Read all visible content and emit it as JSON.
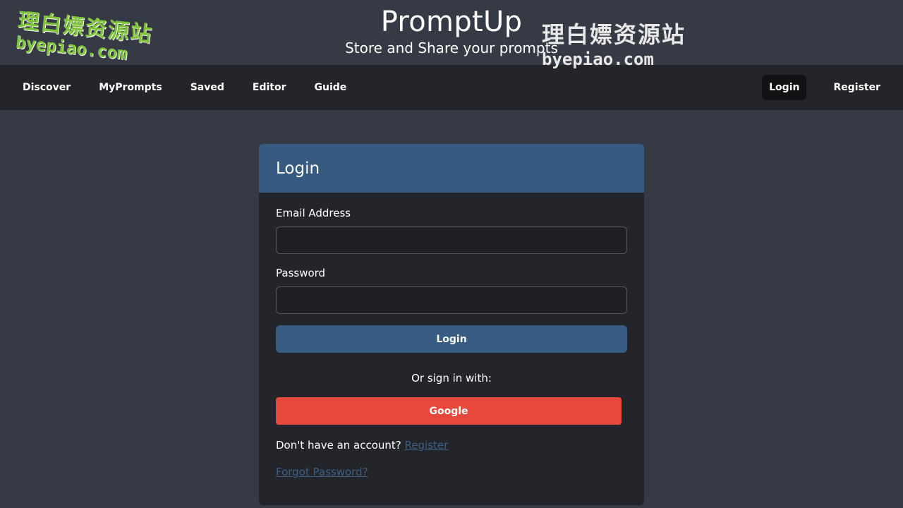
{
  "header": {
    "title": "PromptUp",
    "subtitle": "Store and Share your prompts"
  },
  "nav": {
    "left": [
      {
        "label": "Discover"
      },
      {
        "label": "MyPrompts"
      },
      {
        "label": "Saved"
      },
      {
        "label": "Editor"
      },
      {
        "label": "Guide"
      }
    ],
    "login_label": "Login",
    "register_label": "Register"
  },
  "login_card": {
    "title": "Login",
    "email_label": "Email Address",
    "email_value": "",
    "password_label": "Password",
    "password_value": "",
    "submit_label": "Login",
    "or_text": "Or sign in with:",
    "google_label": "Google",
    "no_account_text": "Don't have an account?",
    "register_link": "Register",
    "forgot_link": "Forgot Password?"
  },
  "watermark": {
    "cn": "理白嫖资源站",
    "en": "byepiao.com"
  },
  "colors": {
    "page_bg": "#363a44",
    "navbar_bg": "#23252a",
    "card_header": "#375a80",
    "login_button": "#385c82",
    "google_button": "#e6493c",
    "link": "#3d5f85"
  }
}
